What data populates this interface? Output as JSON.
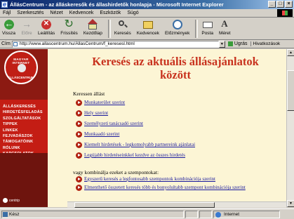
{
  "window": {
    "title": "ÁllásCentrum - az álláskeresők és állashirdetők honlapja - Microsoft Internet Explorer",
    "buttons": [
      "_",
      "□",
      "×"
    ]
  },
  "menu": [
    "Fájl",
    "Szerkesztés",
    "Nézet",
    "Kedvencek",
    "Eszközök",
    "Súgó"
  ],
  "toolbar": {
    "back": "Vissza",
    "forward": "Előre",
    "stop": "Leállítás",
    "refresh": "Frissítés",
    "home": "Kezdőlap",
    "search": "Keresés",
    "favorites": "Kedvencek",
    "history": "Előzmények",
    "mail": "Posta",
    "size": "Méret"
  },
  "address": {
    "label": "Cím",
    "url": "http://www.allascentrum.hu/AllasCentrum/f_keresesl.html",
    "go": "Ugrás",
    "links": "Hivatkozások"
  },
  "logo": {
    "top": "MAGYAR INTERNET",
    "bottom": "ÁLLÁSCENTRUM"
  },
  "sidebar": {
    "items": [
      "ÁLLÁSKERESÉS",
      "HIRDETÉSFELADÁS",
      "SZOLGÁLTATÁSOK",
      "TIPPEK",
      "LINKEK",
      "FEJVADÁSZOK",
      "TÁMOGATÓINK",
      "RÓLUNK",
      "KAPCSOLATOK"
    ],
    "footer": "centrip"
  },
  "main": {
    "title": "Keresés az aktuális állásajánlatok között",
    "section_label": "Keressen állást",
    "links": [
      "Munkaterület szerint",
      "Hely szerint",
      "Személyzeti tanácsadó szerint",
      "Munkaadó szerint",
      "Kiemelt hirdetések - legkomolyabb partnereink ajánlatai",
      "Legújabb hirdetéseinkkel kezdve az összes hirdetés"
    ],
    "combine_label": "vagy kombinálja ezeket a szempontokat:",
    "combo_links": [
      "Egyszerű keresés a legfontosabb szempontok kombinációja szerint",
      "Elmenthető összetett keresés több és bonyolultabb szempont kombinációja szerint"
    ]
  },
  "status": {
    "text": "Kész",
    "zone": "Internet"
  },
  "colors": {
    "title_red": "#c8321e",
    "sidebar_red": "#c41d14",
    "link_blue": "#1a1a9e",
    "page_bg": "#fcf5d5"
  }
}
